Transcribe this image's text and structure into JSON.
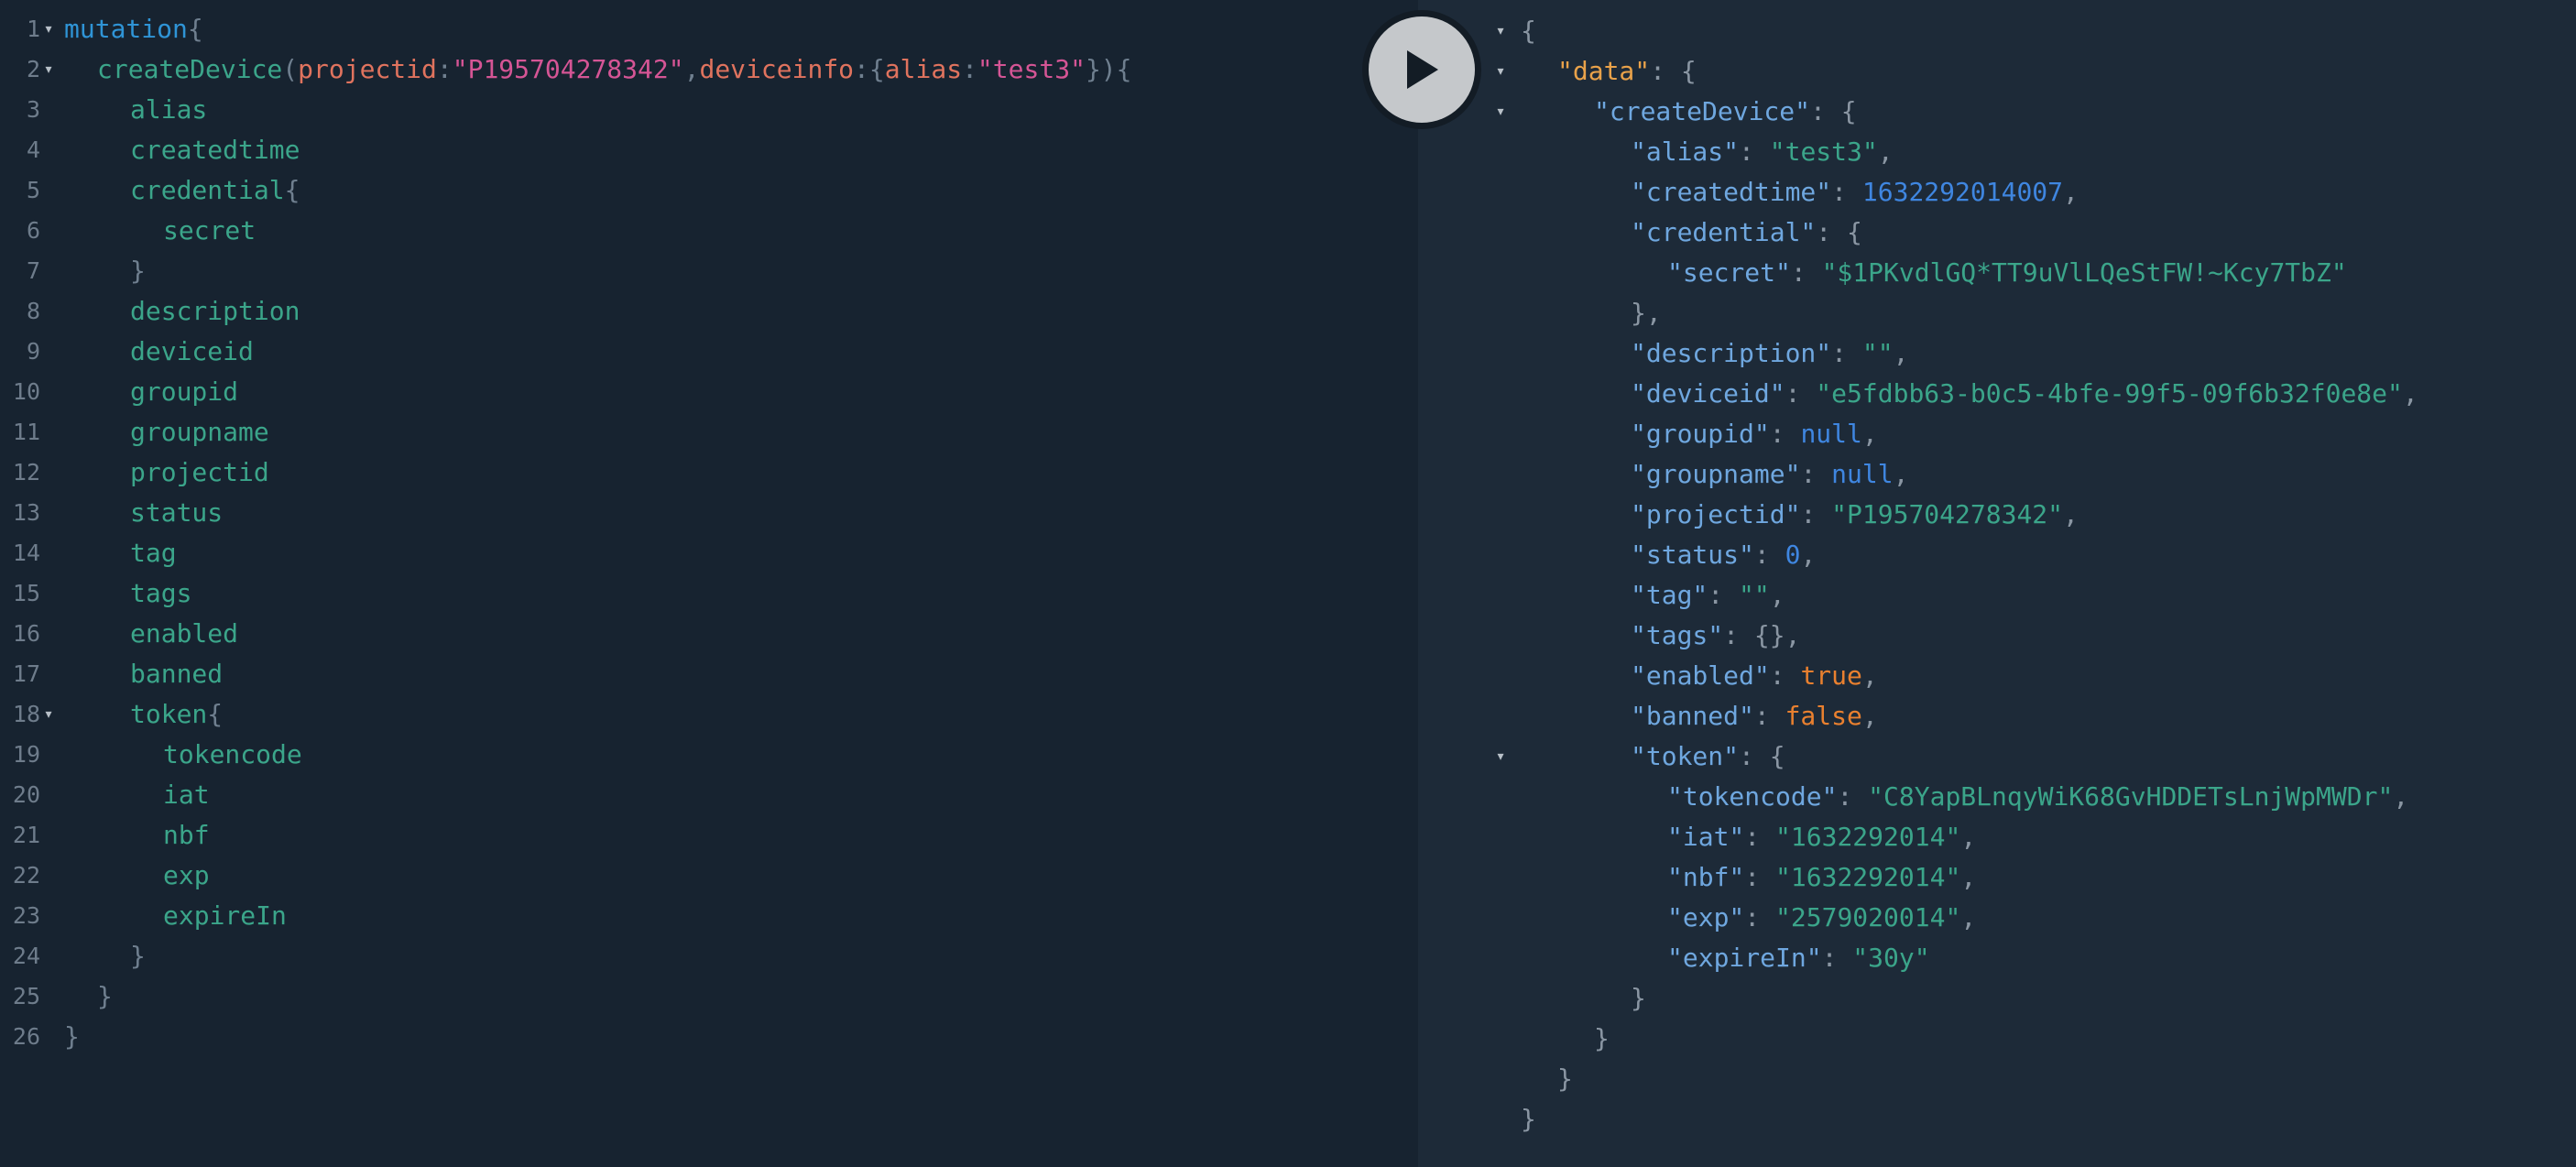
{
  "editor": {
    "lines": [
      {
        "n": "1",
        "fold": true,
        "indent": 0,
        "tokens": [
          {
            "t": "mutation",
            "c": "kw"
          },
          {
            "t": "{",
            "c": "pn"
          }
        ]
      },
      {
        "n": "2",
        "fold": true,
        "indent": 1,
        "tokens": [
          {
            "t": "createDevice",
            "c": "fn"
          },
          {
            "t": "(",
            "c": "pn"
          },
          {
            "t": "projectid",
            "c": "arg"
          },
          {
            "t": ":",
            "c": "pn"
          },
          {
            "t": "\"P195704278342\"",
            "c": "str"
          },
          {
            "t": ",",
            "c": "pn"
          },
          {
            "t": "deviceinfo",
            "c": "arg"
          },
          {
            "t": ":{",
            "c": "pn"
          },
          {
            "t": "alias",
            "c": "arg"
          },
          {
            "t": ":",
            "c": "pn"
          },
          {
            "t": "\"test3\"",
            "c": "str"
          },
          {
            "t": "}){",
            "c": "pn"
          }
        ]
      },
      {
        "n": "3",
        "fold": false,
        "indent": 2,
        "tokens": [
          {
            "t": "alias",
            "c": "fld"
          }
        ]
      },
      {
        "n": "4",
        "fold": false,
        "indent": 2,
        "tokens": [
          {
            "t": "createdtime",
            "c": "fld"
          }
        ]
      },
      {
        "n": "5",
        "fold": false,
        "indent": 2,
        "tokens": [
          {
            "t": "credential",
            "c": "fld"
          },
          {
            "t": "{",
            "c": "pn"
          }
        ]
      },
      {
        "n": "6",
        "fold": false,
        "indent": 3,
        "tokens": [
          {
            "t": "secret",
            "c": "fld"
          }
        ]
      },
      {
        "n": "7",
        "fold": false,
        "indent": 2,
        "tokens": [
          {
            "t": "}",
            "c": "pn"
          }
        ]
      },
      {
        "n": "8",
        "fold": false,
        "indent": 2,
        "tokens": [
          {
            "t": "description",
            "c": "fld"
          }
        ]
      },
      {
        "n": "9",
        "fold": false,
        "indent": 2,
        "tokens": [
          {
            "t": "deviceid",
            "c": "fld"
          }
        ]
      },
      {
        "n": "10",
        "fold": false,
        "indent": 2,
        "tokens": [
          {
            "t": "groupid",
            "c": "fld"
          }
        ]
      },
      {
        "n": "11",
        "fold": false,
        "indent": 2,
        "tokens": [
          {
            "t": "groupname",
            "c": "fld"
          }
        ]
      },
      {
        "n": "12",
        "fold": false,
        "indent": 2,
        "tokens": [
          {
            "t": "projectid",
            "c": "fld"
          }
        ]
      },
      {
        "n": "13",
        "fold": false,
        "indent": 2,
        "tokens": [
          {
            "t": "status",
            "c": "fld"
          }
        ]
      },
      {
        "n": "14",
        "fold": false,
        "indent": 2,
        "tokens": [
          {
            "t": "tag",
            "c": "fld"
          }
        ]
      },
      {
        "n": "15",
        "fold": false,
        "indent": 2,
        "tokens": [
          {
            "t": "tags",
            "c": "fld"
          }
        ]
      },
      {
        "n": "16",
        "fold": false,
        "indent": 2,
        "tokens": [
          {
            "t": "enabled",
            "c": "fld"
          }
        ]
      },
      {
        "n": "17",
        "fold": false,
        "indent": 2,
        "tokens": [
          {
            "t": "banned",
            "c": "fld"
          }
        ]
      },
      {
        "n": "18",
        "fold": true,
        "indent": 2,
        "tokens": [
          {
            "t": "token",
            "c": "fld"
          },
          {
            "t": "{",
            "c": "pn"
          }
        ]
      },
      {
        "n": "19",
        "fold": false,
        "indent": 3,
        "tokens": [
          {
            "t": "tokencode",
            "c": "fld"
          }
        ]
      },
      {
        "n": "20",
        "fold": false,
        "indent": 3,
        "tokens": [
          {
            "t": "iat",
            "c": "fld"
          }
        ]
      },
      {
        "n": "21",
        "fold": false,
        "indent": 3,
        "tokens": [
          {
            "t": "nbf",
            "c": "fld"
          }
        ]
      },
      {
        "n": "22",
        "fold": false,
        "indent": 3,
        "tokens": [
          {
            "t": "exp",
            "c": "fld"
          }
        ]
      },
      {
        "n": "23",
        "fold": false,
        "indent": 3,
        "tokens": [
          {
            "t": "expireIn",
            "c": "fld"
          }
        ]
      },
      {
        "n": "24",
        "fold": false,
        "indent": 2,
        "tokens": [
          {
            "t": "}",
            "c": "pn"
          }
        ]
      },
      {
        "n": "25",
        "fold": false,
        "indent": 1,
        "tokens": [
          {
            "t": "}",
            "c": "pn"
          }
        ]
      },
      {
        "n": "26",
        "fold": false,
        "indent": 0,
        "tokens": [
          {
            "t": "}",
            "c": "pn"
          }
        ]
      }
    ]
  },
  "result": {
    "lines": [
      {
        "fold": true,
        "indent": 0,
        "tokens": [
          {
            "t": "{",
            "c": "rp"
          }
        ]
      },
      {
        "fold": true,
        "indent": 1,
        "tokens": [
          {
            "t": "\"data\"",
            "c": "dkey"
          },
          {
            "t": ": {",
            "c": "rp"
          }
        ]
      },
      {
        "fold": true,
        "indent": 2,
        "tokens": [
          {
            "t": "\"createDevice\"",
            "c": "key"
          },
          {
            "t": ": {",
            "c": "rp"
          }
        ]
      },
      {
        "fold": false,
        "indent": 3,
        "tokens": [
          {
            "t": "\"alias\"",
            "c": "key"
          },
          {
            "t": ": ",
            "c": "rp"
          },
          {
            "t": "\"test3\"",
            "c": "rstr"
          },
          {
            "t": ",",
            "c": "rp"
          }
        ]
      },
      {
        "fold": false,
        "indent": 3,
        "tokens": [
          {
            "t": "\"createdtime\"",
            "c": "key"
          },
          {
            "t": ": ",
            "c": "rp"
          },
          {
            "t": "1632292014007",
            "c": "num"
          },
          {
            "t": ",",
            "c": "rp"
          }
        ]
      },
      {
        "fold": false,
        "indent": 3,
        "tokens": [
          {
            "t": "\"credential\"",
            "c": "key"
          },
          {
            "t": ": {",
            "c": "rp"
          }
        ]
      },
      {
        "fold": false,
        "indent": 4,
        "tokens": [
          {
            "t": "\"secret\"",
            "c": "key"
          },
          {
            "t": ": ",
            "c": "rp"
          },
          {
            "t": "\"$1PKvdlGQ*TT9uVlLQeStFW!~Kcy7TbZ\"",
            "c": "rstr"
          }
        ]
      },
      {
        "fold": false,
        "indent": 3,
        "tokens": [
          {
            "t": "},",
            "c": "rp"
          }
        ]
      },
      {
        "fold": false,
        "indent": 3,
        "tokens": [
          {
            "t": "\"description\"",
            "c": "key"
          },
          {
            "t": ": ",
            "c": "rp"
          },
          {
            "t": "\"\"",
            "c": "rstr"
          },
          {
            "t": ",",
            "c": "rp"
          }
        ]
      },
      {
        "fold": false,
        "indent": 3,
        "tokens": [
          {
            "t": "\"deviceid\"",
            "c": "key"
          },
          {
            "t": ": ",
            "c": "rp"
          },
          {
            "t": "\"e5fdbb63-b0c5-4bfe-99f5-09f6b32f0e8e\"",
            "c": "rstr"
          },
          {
            "t": ",",
            "c": "rp"
          }
        ]
      },
      {
        "fold": false,
        "indent": 3,
        "tokens": [
          {
            "t": "\"groupid\"",
            "c": "key"
          },
          {
            "t": ": ",
            "c": "rp"
          },
          {
            "t": "null",
            "c": "nul"
          },
          {
            "t": ",",
            "c": "rp"
          }
        ]
      },
      {
        "fold": false,
        "indent": 3,
        "tokens": [
          {
            "t": "\"groupname\"",
            "c": "key"
          },
          {
            "t": ": ",
            "c": "rp"
          },
          {
            "t": "null",
            "c": "nul"
          },
          {
            "t": ",",
            "c": "rp"
          }
        ]
      },
      {
        "fold": false,
        "indent": 3,
        "tokens": [
          {
            "t": "\"projectid\"",
            "c": "key"
          },
          {
            "t": ": ",
            "c": "rp"
          },
          {
            "t": "\"P195704278342\"",
            "c": "rstr"
          },
          {
            "t": ",",
            "c": "rp"
          }
        ]
      },
      {
        "fold": false,
        "indent": 3,
        "tokens": [
          {
            "t": "\"status\"",
            "c": "key"
          },
          {
            "t": ": ",
            "c": "rp"
          },
          {
            "t": "0",
            "c": "num"
          },
          {
            "t": ",",
            "c": "rp"
          }
        ]
      },
      {
        "fold": false,
        "indent": 3,
        "tokens": [
          {
            "t": "\"tag\"",
            "c": "key"
          },
          {
            "t": ": ",
            "c": "rp"
          },
          {
            "t": "\"\"",
            "c": "rstr"
          },
          {
            "t": ",",
            "c": "rp"
          }
        ]
      },
      {
        "fold": false,
        "indent": 3,
        "tokens": [
          {
            "t": "\"tags\"",
            "c": "key"
          },
          {
            "t": ": {},",
            "c": "rp"
          }
        ]
      },
      {
        "fold": false,
        "indent": 3,
        "tokens": [
          {
            "t": "\"enabled\"",
            "c": "key"
          },
          {
            "t": ": ",
            "c": "rp"
          },
          {
            "t": "true",
            "c": "bool"
          },
          {
            "t": ",",
            "c": "rp"
          }
        ]
      },
      {
        "fold": false,
        "indent": 3,
        "tokens": [
          {
            "t": "\"banned\"",
            "c": "key"
          },
          {
            "t": ": ",
            "c": "rp"
          },
          {
            "t": "false",
            "c": "bool"
          },
          {
            "t": ",",
            "c": "rp"
          }
        ]
      },
      {
        "fold": true,
        "indent": 3,
        "tokens": [
          {
            "t": "\"token\"",
            "c": "key"
          },
          {
            "t": ": {",
            "c": "rp"
          }
        ]
      },
      {
        "fold": false,
        "indent": 4,
        "tokens": [
          {
            "t": "\"tokencode\"",
            "c": "key"
          },
          {
            "t": ": ",
            "c": "rp"
          },
          {
            "t": "\"C8YapBLnqyWiK68GvHDDETsLnjWpMWDr\"",
            "c": "rstr"
          },
          {
            "t": ",",
            "c": "rp"
          }
        ]
      },
      {
        "fold": false,
        "indent": 4,
        "tokens": [
          {
            "t": "\"iat\"",
            "c": "key"
          },
          {
            "t": ": ",
            "c": "rp"
          },
          {
            "t": "\"1632292014\"",
            "c": "rstr"
          },
          {
            "t": ",",
            "c": "rp"
          }
        ]
      },
      {
        "fold": false,
        "indent": 4,
        "tokens": [
          {
            "t": "\"nbf\"",
            "c": "key"
          },
          {
            "t": ": ",
            "c": "rp"
          },
          {
            "t": "\"1632292014\"",
            "c": "rstr"
          },
          {
            "t": ",",
            "c": "rp"
          }
        ]
      },
      {
        "fold": false,
        "indent": 4,
        "tokens": [
          {
            "t": "\"exp\"",
            "c": "key"
          },
          {
            "t": ": ",
            "c": "rp"
          },
          {
            "t": "\"2579020014\"",
            "c": "rstr"
          },
          {
            "t": ",",
            "c": "rp"
          }
        ]
      },
      {
        "fold": false,
        "indent": 4,
        "tokens": [
          {
            "t": "\"expireIn\"",
            "c": "key"
          },
          {
            "t": ": ",
            "c": "rp"
          },
          {
            "t": "\"30y\"",
            "c": "rstr"
          }
        ]
      },
      {
        "fold": false,
        "indent": 3,
        "tokens": [
          {
            "t": "}",
            "c": "rp"
          }
        ]
      },
      {
        "fold": false,
        "indent": 2,
        "tokens": [
          {
            "t": "}",
            "c": "rp"
          }
        ]
      },
      {
        "fold": false,
        "indent": 1,
        "tokens": [
          {
            "t": "}",
            "c": "rp"
          }
        ]
      },
      {
        "fold": false,
        "indent": 0,
        "tokens": [
          {
            "t": "}",
            "c": "rp"
          }
        ]
      }
    ]
  },
  "run_button": {
    "icon": "play-icon"
  },
  "colors": {
    "editor_bg": "#172330",
    "result_bg": "#1d2a38",
    "keyword": "#2f94d6",
    "field": "#3ba58a",
    "argument": "#e0735e",
    "string": "#d55595",
    "json_key": "#6fa7df",
    "number": "#3f86e0",
    "boolean": "#e9802f",
    "data_key": "#e9a24a"
  }
}
